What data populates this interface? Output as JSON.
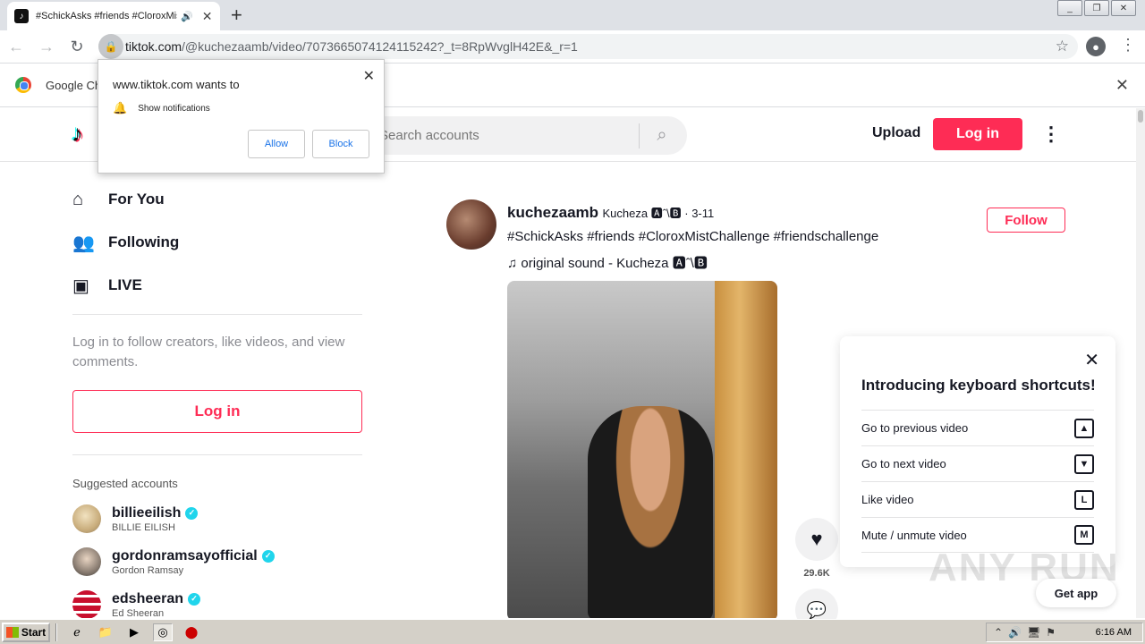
{
  "browser": {
    "tab_title": "#SchickAsks #friends #CloroxMistChallenge",
    "tab_audio_icon": "speaker-icon",
    "url_host": "tiktok.com",
    "url_path": "/@kuchezaamb/video/7073665074124115242?_t=8RpWvglH42E&_r=1",
    "infobar_text": "Google Ch"
  },
  "notification": {
    "title": "www.tiktok.com wants to",
    "permission": "Show notifications",
    "allow": "Allow",
    "block": "Block"
  },
  "header": {
    "logo_icon": "tiktok-logo-icon",
    "search_placeholder": "Search accounts",
    "upload": "Upload",
    "login": "Log in"
  },
  "sidebar": {
    "nav": [
      {
        "label": "For You",
        "icon": "home-icon"
      },
      {
        "label": "Following",
        "icon": "users-icon"
      },
      {
        "label": "LIVE",
        "icon": "live-icon"
      }
    ],
    "message": "Log in to follow creators, like videos, and view comments.",
    "login": "Log in",
    "suggested_title": "Suggested accounts",
    "suggested": [
      {
        "name": "billieeilish",
        "sub": "BILLIE EILISH"
      },
      {
        "name": "gordonramsayofficial",
        "sub": "Gordon Ramsay"
      },
      {
        "name": "edsheeran",
        "sub": "Ed Sheeran"
      }
    ]
  },
  "post": {
    "username": "kuchezaamb",
    "nickname": "Kucheza 🅰ˆ\\🅱 · 3-11",
    "caption": "#SchickAsks #friends #CloroxMistChallenge #friendschallenge",
    "sound": "original sound - Kucheza 🅰ˆ\\🅱",
    "follow": "Follow",
    "likes": "29.6K"
  },
  "shortcuts": {
    "title": "Introducing keyboard shortcuts!",
    "items": [
      {
        "label": "Go to previous video",
        "key": "▲"
      },
      {
        "label": "Go to next video",
        "key": "▼"
      },
      {
        "label": "Like video",
        "key": "L"
      },
      {
        "label": "Mute / unmute video",
        "key": "M"
      }
    ]
  },
  "get_app": "Get app",
  "watermark": "ANY RUN",
  "taskbar": {
    "start": "Start",
    "time": "6:16 AM"
  },
  "colors": {
    "brand": "#fe2c55",
    "verified": "#20d5ec"
  }
}
